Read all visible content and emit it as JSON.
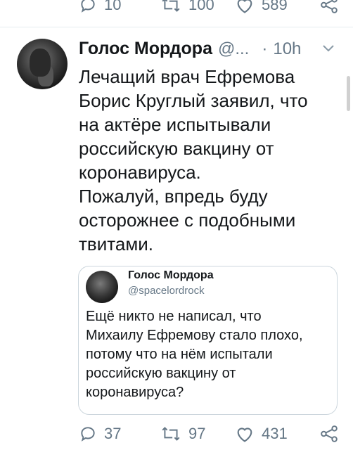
{
  "top_actions": {
    "replies": "10",
    "retweets": "100",
    "likes": "589"
  },
  "tweet": {
    "author_name": "Голос Мордора",
    "handle_truncated": "@...",
    "separator": "·",
    "time": "10h",
    "text_lines": [
      "Лечащий врач Ефремова",
      "Борис Круглый заявил, что",
      "на актёре испытывали",
      "российскую вакцину от",
      "коронавируса.",
      "Пожалуй, впредь буду",
      "осторожнее с подобными",
      "твитами."
    ]
  },
  "quoted_tweet": {
    "author_name": "Голос Мордора",
    "handle": "@spacelordrock",
    "text_lines": [
      "Ещё никто не написал, что",
      "Михаилу Ефремову стало плохо,",
      "потому что на нём испытали",
      "российскую вакцину от",
      "коронавируса?"
    ]
  },
  "bottom_actions": {
    "replies": "37",
    "retweets": "97",
    "likes": "431"
  },
  "icons": {
    "reply": "reply-icon",
    "retweet": "retweet-icon",
    "like": "heart-icon",
    "share": "share-icon",
    "menu": "chevron-down-icon"
  },
  "colors": {
    "text": "#14171a",
    "secondary": "#657786",
    "border": "#ccd6dd"
  }
}
